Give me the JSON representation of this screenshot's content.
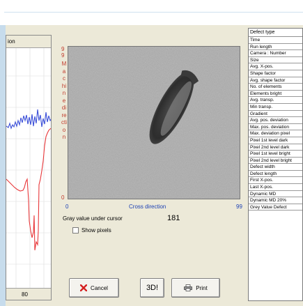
{
  "profile": {
    "header": "ion",
    "tick_label": "80"
  },
  "image_panel": {
    "machine_direction_label": "Machine direction",
    "v_axis_top": "99",
    "v_axis_bottom": "0",
    "x_axis_left": "0",
    "x_axis_label": "Cross direction",
    "x_axis_right": "99",
    "gray_label": "Gray value under cursor",
    "gray_value": "181",
    "show_pixels_label": "Show pixels"
  },
  "buttons": {
    "cancel_label": "Cancel",
    "threed_label": "3D!",
    "print_label": "Print"
  },
  "properties": {
    "header": "Defect type",
    "rows": [
      "Time",
      "Run length",
      "Camera : Number",
      "Size",
      "Avg. X-pos.",
      "Shape factor",
      "Avg. shape factor",
      "No. of elements",
      "Elements bright",
      "Avg. transp.",
      "Min transp.",
      "Gradient",
      "Avg. pos. deviation",
      "Max. pos. deviation",
      "Max. deviation pixel",
      "Pixel 1st level dark",
      "Pixel 2nd level dark",
      "Pixel 1st level bright",
      "Pixel 2nd level bright",
      "Defect width",
      "Defect length",
      "First X-pos.",
      "Last X-pos.",
      "Dynamic MD",
      "Dynamic MD 20%",
      "Grey Value Defect"
    ]
  },
  "colors": {
    "red_series": "#e8373a",
    "blue_series": "#3b4fd8",
    "axis_red": "#c0392b",
    "axis_blue": "#1a3fb3"
  },
  "icons": {
    "cancel": "red-x-icon",
    "print": "printer-icon"
  }
}
